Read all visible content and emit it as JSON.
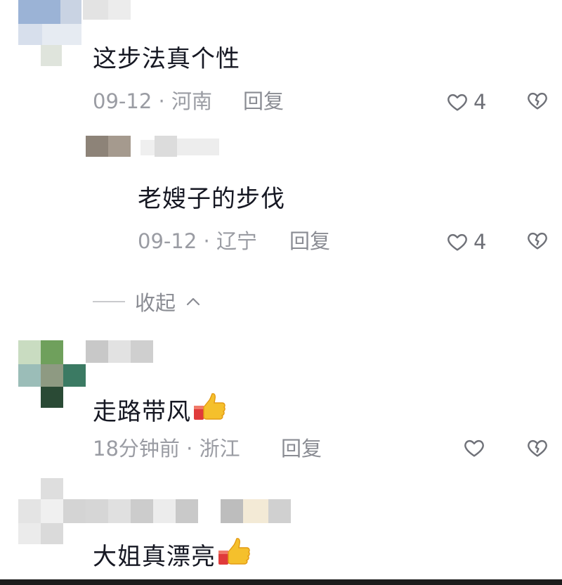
{
  "comments": [
    {
      "text": "这步法真个性",
      "date": "09-12",
      "location": "河南",
      "reply_label": "回复",
      "likes": "4",
      "has_emoji": false,
      "replies": [
        {
          "text": "老嫂子的步伐",
          "date": "09-12",
          "location": "辽宁",
          "reply_label": "回复",
          "likes": "4"
        }
      ],
      "collapse_label": "收起"
    },
    {
      "text": "走路带风",
      "date": "18分钟前",
      "location": "浙江",
      "reply_label": "回复",
      "likes": "",
      "has_emoji": true,
      "emoji": "thumbs-up"
    },
    {
      "text": "大姐真漂亮",
      "has_emoji": true,
      "emoji": "thumbs-up"
    }
  ],
  "separator": "·",
  "icons": {
    "like": "heart-outline-icon",
    "dislike": "broken-heart-icon",
    "collapse_arrow": "chevron-up-icon",
    "emoji": "thumbs-up-emoji-icon"
  },
  "colors": {
    "text": "#161823",
    "meta": "#9a9ca3",
    "icon": "#6f7178"
  }
}
